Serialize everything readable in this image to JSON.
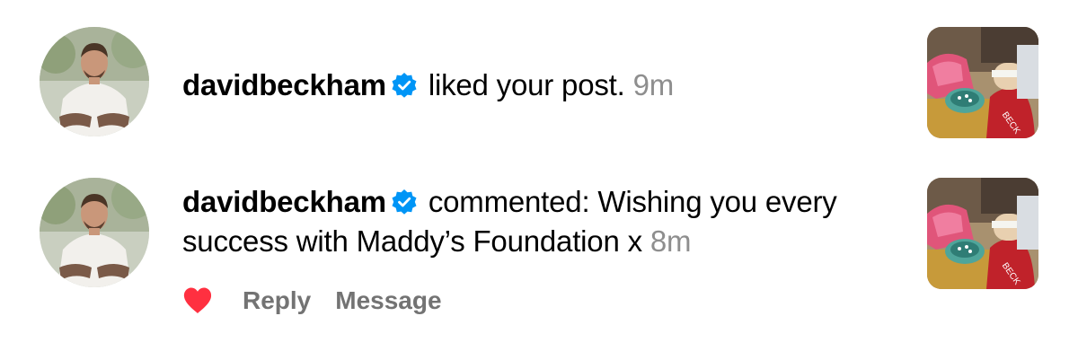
{
  "notifications": [
    {
      "username": "davidbeckham",
      "verified_icon": "verified-badge-icon",
      "action_text": "liked your post.",
      "timestamp": "9m",
      "avatar_icon": "profile-avatar",
      "thumbnail_icon": "post-thumbnail"
    },
    {
      "username": "davidbeckham",
      "verified_icon": "verified-badge-icon",
      "action_text": "commented: Wishing you every success with Maddy’s Foundation x",
      "timestamp": "8m",
      "avatar_icon": "profile-avatar",
      "thumbnail_icon": "post-thumbnail",
      "actions": {
        "like_icon": "heart-icon",
        "reply_label": "Reply",
        "message_label": "Message"
      }
    }
  ],
  "colors": {
    "verified_blue": "#0095f6",
    "timestamp_gray": "#8e8e8e",
    "action_gray": "#737373",
    "heart_red": "#ff3040"
  }
}
